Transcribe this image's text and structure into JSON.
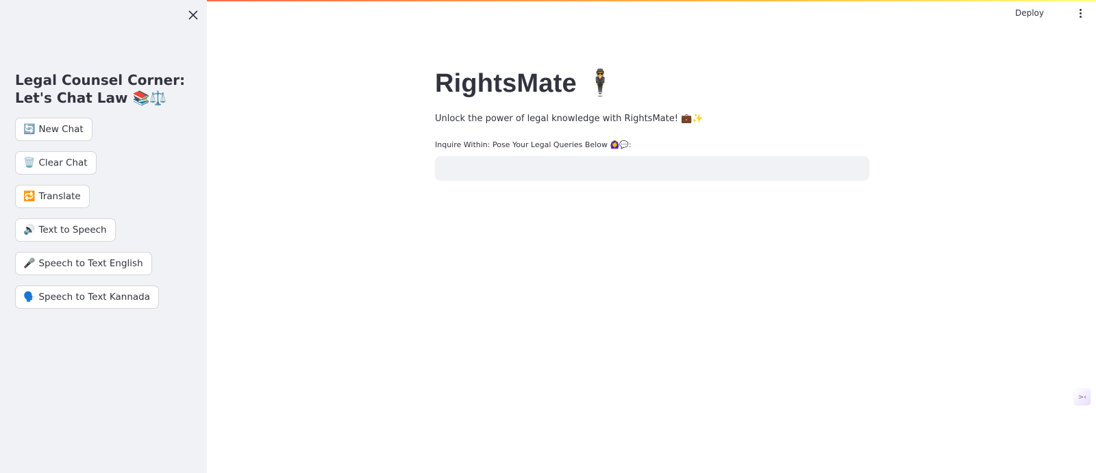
{
  "sidebar": {
    "title": "Legal Counsel Corner: Let's Chat Law 📚⚖️",
    "buttons": [
      {
        "icon": "🔄",
        "label": "New Chat"
      },
      {
        "icon": "🗑️",
        "label": "Clear Chat"
      },
      {
        "icon": "🔁",
        "label": "Translate"
      },
      {
        "icon": "🔊",
        "label": "Text to Speech"
      },
      {
        "icon": "🎤",
        "label": "Speech to Text English"
      },
      {
        "icon": "🗣️",
        "label": "Speech to Text Kannada"
      }
    ]
  },
  "header": {
    "deploy_label": "Deploy"
  },
  "main": {
    "title": "RightsMate 🕴️",
    "subtitle": "Unlock the power of legal knowledge with RightsMate! 💼✨",
    "input_label": "Inquire Within: Pose Your Legal Queries Below 🙆‍♀️💬:",
    "input_value": "",
    "corner_widget_text": ">‹"
  },
  "colors": {
    "sidebar_bg": "#f0f2f6",
    "text": "#31333f",
    "accent_start": "#ff4b4b",
    "accent_end": "#fffd80"
  }
}
